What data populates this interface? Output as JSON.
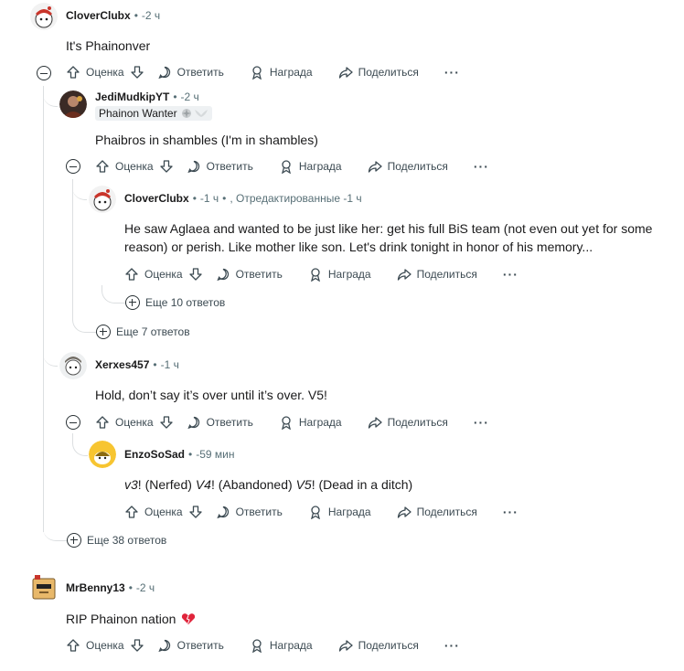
{
  "comments": [
    {
      "username": "CloverClubx",
      "time": "-2 ч",
      "body": "It's Phainonver",
      "actions": {
        "vote": "Оценка",
        "reply": "Ответить",
        "award": "Награда",
        "share": "Поделиться"
      }
    },
    {
      "username": "JediMudkipYT",
      "time": "-2 ч",
      "flair": "Phainon Wanter",
      "body": "Phaibros in shambles (I'm in shambles)",
      "actions": {
        "vote": "Оценка",
        "reply": "Ответить",
        "award": "Награда",
        "share": "Поделиться"
      }
    },
    {
      "username": "CloverClubx",
      "time": "-1 ч",
      "edited": ", Отредактированные -1 ч",
      "body_line1": "He saw Aglaea and wanted to be just like her: get his full BiS team (not even out yet for some",
      "body_line2": "reason) or perish. Like mother like son. Let's drink tonight in honor of his memory...",
      "actions": {
        "vote": "Оценка",
        "reply": "Ответить",
        "award": "Награда",
        "share": "Поделиться"
      },
      "more": "Еще 10 ответов"
    },
    {
      "more_after_jedi": "Еще 7 ответов"
    },
    {
      "username": "Xerxes457",
      "time": "-1 ч",
      "body": "Hold, don’t say it’s over until it’s over. V5!",
      "actions": {
        "vote": "Оценка",
        "reply": "Ответить",
        "award": "Награда",
        "share": "Поделиться"
      }
    },
    {
      "username": "EnzoSoSad",
      "time": "-59 мин",
      "body_parts": [
        "v3",
        "! (Nerfed) ",
        "V4",
        "! (Abandoned) ",
        "V5",
        "! (Dead in a ditch)"
      ],
      "actions": {
        "vote": "Оценка",
        "reply": "Ответить",
        "award": "Награда",
        "share": "Поделиться"
      }
    },
    {
      "more_root": "Еще 38 ответов"
    },
    {
      "username": "MrBenny13",
      "time": "-2 ч",
      "body": "RIP Phainon nation",
      "actions": {
        "vote": "Оценка",
        "reply": "Ответить",
        "award": "Награда",
        "share": "Поделиться"
      }
    }
  ],
  "colors": {
    "heart": "#e0243b",
    "text": "#1a1a1b",
    "meta": "#576f76",
    "line": "#dcdfe1"
  }
}
